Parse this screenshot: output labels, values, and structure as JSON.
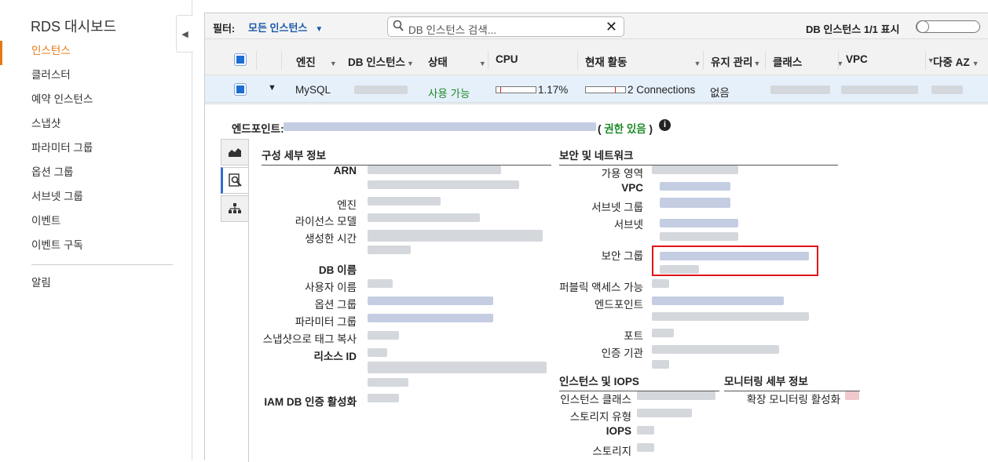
{
  "sidebar": {
    "title": "RDS 대시보드",
    "items": [
      {
        "label": "인스턴스",
        "active": true
      },
      {
        "label": "클러스터"
      },
      {
        "label": "예약 인스턴스"
      },
      {
        "label": "스냅샷"
      },
      {
        "label": "파라미터 그룹"
      },
      {
        "label": "옵션 그룹"
      },
      {
        "label": "서브넷 그룹"
      },
      {
        "label": "이벤트"
      },
      {
        "label": "이벤트 구독"
      }
    ],
    "footer_item": "알림"
  },
  "filterbar": {
    "filter_label": "필터:",
    "filter_value": "모든 인스턴스",
    "search_placeholder": "DB 인스턴스 검색...",
    "count_text": "DB 인스턴스 1/1 표시"
  },
  "table": {
    "headers": {
      "engine": "엔진",
      "db_instance": "DB 인스턴스",
      "status": "상태",
      "cpu": "CPU",
      "activity": "현재 활동",
      "maintenance": "유지 관리",
      "class": "클래스",
      "vpc": "VPC",
      "multi_az": "다중 AZ"
    },
    "row": {
      "engine": "MySQL",
      "status": "사용 가능",
      "cpu": "1.17%",
      "cpu_fraction": 0.0117,
      "activity": "2 Connections",
      "maintenance": "없음"
    }
  },
  "details": {
    "endpoint_label": "엔드포인트:",
    "permission_open": "( ",
    "permission_text": "권한 있음",
    "permission_close": " )",
    "config": {
      "title": "구성 세부 정보",
      "labels": {
        "arn": "ARN",
        "engine": "엔진",
        "license": "라이선스 모델",
        "created": "생성한 시간",
        "db_name": "DB 이름",
        "username": "사용자 이름",
        "option_group": "옵션 그룹",
        "param_group": "파라미터 그룹",
        "copy_tags": "스냅샷으로 태그 복사",
        "resource_id": "리소스 ID",
        "iam_auth": "IAM DB 인증 활성화"
      }
    },
    "security": {
      "title": "보안 및 네트워크",
      "labels": {
        "az": "가용 영역",
        "vpc": "VPC",
        "subnet_group": "서브넷 그룹",
        "subnet": "서브넷",
        "security_group": "보안 그룹",
        "public": "퍼블릭 액세스 가능",
        "endpoint": "엔드포인트",
        "port": "포트",
        "ca": "인증 기관"
      }
    },
    "iops": {
      "title": "인스턴스 및 IOPS",
      "labels": {
        "class": "인스턴스 클래스",
        "storage_type": "스토리지 유형",
        "iops": "IOPS",
        "storage": "스토리지"
      }
    },
    "monitoring": {
      "title": "모니터링 세부 정보",
      "labels": {
        "enhanced": "확장 모니터링 활성화"
      }
    }
  },
  "colors": {
    "accent": "#e47911",
    "link": "#1a5aa8",
    "status_ok": "#1e8a2a",
    "highlight": "#e0141a",
    "checkbox": "#1d6cd1"
  }
}
